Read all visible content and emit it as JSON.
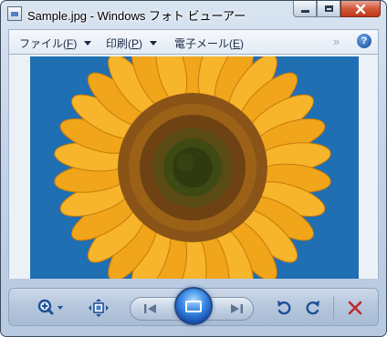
{
  "window": {
    "title": "Sample.jpg - Windows フォト ビューアー"
  },
  "menu": {
    "file": {
      "label": "ファイル(",
      "accel": "F",
      "close": ")"
    },
    "print": {
      "label": "印刷(",
      "accel": "P",
      "close": ")"
    },
    "email": {
      "label": "電子メール(",
      "accel": "E",
      "close": ")"
    },
    "more_glyph": "»",
    "help_glyph": "?"
  },
  "image": {
    "subject": "sunflower",
    "colors": {
      "sky": "#1f6fb2",
      "petal": "#f0a51a",
      "disk": "#8a5418",
      "center": "#3f4a12"
    }
  },
  "controls": {
    "zoom_icon": "zoom-icon",
    "actual_size_icon": "fit-to-window-icon",
    "previous_icon": "previous-icon",
    "slideshow_icon": "slideshow-icon",
    "next_icon": "next-icon",
    "rotate_left_icon": "rotate-counterclockwise-icon",
    "rotate_right_icon": "rotate-clockwise-icon",
    "delete_icon": "delete-icon"
  }
}
